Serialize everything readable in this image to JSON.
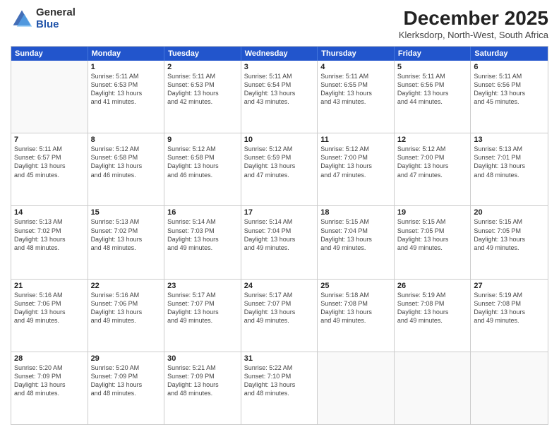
{
  "logo": {
    "general": "General",
    "blue": "Blue"
  },
  "title": "December 2025",
  "location": "Klerksdorp, North-West, South Africa",
  "header_days": [
    "Sunday",
    "Monday",
    "Tuesday",
    "Wednesday",
    "Thursday",
    "Friday",
    "Saturday"
  ],
  "weeks": [
    [
      {
        "day": "",
        "lines": []
      },
      {
        "day": "1",
        "lines": [
          "Sunrise: 5:11 AM",
          "Sunset: 6:53 PM",
          "Daylight: 13 hours",
          "and 41 minutes."
        ]
      },
      {
        "day": "2",
        "lines": [
          "Sunrise: 5:11 AM",
          "Sunset: 6:53 PM",
          "Daylight: 13 hours",
          "and 42 minutes."
        ]
      },
      {
        "day": "3",
        "lines": [
          "Sunrise: 5:11 AM",
          "Sunset: 6:54 PM",
          "Daylight: 13 hours",
          "and 43 minutes."
        ]
      },
      {
        "day": "4",
        "lines": [
          "Sunrise: 5:11 AM",
          "Sunset: 6:55 PM",
          "Daylight: 13 hours",
          "and 43 minutes."
        ]
      },
      {
        "day": "5",
        "lines": [
          "Sunrise: 5:11 AM",
          "Sunset: 6:56 PM",
          "Daylight: 13 hours",
          "and 44 minutes."
        ]
      },
      {
        "day": "6",
        "lines": [
          "Sunrise: 5:11 AM",
          "Sunset: 6:56 PM",
          "Daylight: 13 hours",
          "and 45 minutes."
        ]
      }
    ],
    [
      {
        "day": "7",
        "lines": [
          "Sunrise: 5:11 AM",
          "Sunset: 6:57 PM",
          "Daylight: 13 hours",
          "and 45 minutes."
        ]
      },
      {
        "day": "8",
        "lines": [
          "Sunrise: 5:12 AM",
          "Sunset: 6:58 PM",
          "Daylight: 13 hours",
          "and 46 minutes."
        ]
      },
      {
        "day": "9",
        "lines": [
          "Sunrise: 5:12 AM",
          "Sunset: 6:58 PM",
          "Daylight: 13 hours",
          "and 46 minutes."
        ]
      },
      {
        "day": "10",
        "lines": [
          "Sunrise: 5:12 AM",
          "Sunset: 6:59 PM",
          "Daylight: 13 hours",
          "and 47 minutes."
        ]
      },
      {
        "day": "11",
        "lines": [
          "Sunrise: 5:12 AM",
          "Sunset: 7:00 PM",
          "Daylight: 13 hours",
          "and 47 minutes."
        ]
      },
      {
        "day": "12",
        "lines": [
          "Sunrise: 5:12 AM",
          "Sunset: 7:00 PM",
          "Daylight: 13 hours",
          "and 47 minutes."
        ]
      },
      {
        "day": "13",
        "lines": [
          "Sunrise: 5:13 AM",
          "Sunset: 7:01 PM",
          "Daylight: 13 hours",
          "and 48 minutes."
        ]
      }
    ],
    [
      {
        "day": "14",
        "lines": [
          "Sunrise: 5:13 AM",
          "Sunset: 7:02 PM",
          "Daylight: 13 hours",
          "and 48 minutes."
        ]
      },
      {
        "day": "15",
        "lines": [
          "Sunrise: 5:13 AM",
          "Sunset: 7:02 PM",
          "Daylight: 13 hours",
          "and 48 minutes."
        ]
      },
      {
        "day": "16",
        "lines": [
          "Sunrise: 5:14 AM",
          "Sunset: 7:03 PM",
          "Daylight: 13 hours",
          "and 49 minutes."
        ]
      },
      {
        "day": "17",
        "lines": [
          "Sunrise: 5:14 AM",
          "Sunset: 7:04 PM",
          "Daylight: 13 hours",
          "and 49 minutes."
        ]
      },
      {
        "day": "18",
        "lines": [
          "Sunrise: 5:15 AM",
          "Sunset: 7:04 PM",
          "Daylight: 13 hours",
          "and 49 minutes."
        ]
      },
      {
        "day": "19",
        "lines": [
          "Sunrise: 5:15 AM",
          "Sunset: 7:05 PM",
          "Daylight: 13 hours",
          "and 49 minutes."
        ]
      },
      {
        "day": "20",
        "lines": [
          "Sunrise: 5:15 AM",
          "Sunset: 7:05 PM",
          "Daylight: 13 hours",
          "and 49 minutes."
        ]
      }
    ],
    [
      {
        "day": "21",
        "lines": [
          "Sunrise: 5:16 AM",
          "Sunset: 7:06 PM",
          "Daylight: 13 hours",
          "and 49 minutes."
        ]
      },
      {
        "day": "22",
        "lines": [
          "Sunrise: 5:16 AM",
          "Sunset: 7:06 PM",
          "Daylight: 13 hours",
          "and 49 minutes."
        ]
      },
      {
        "day": "23",
        "lines": [
          "Sunrise: 5:17 AM",
          "Sunset: 7:07 PM",
          "Daylight: 13 hours",
          "and 49 minutes."
        ]
      },
      {
        "day": "24",
        "lines": [
          "Sunrise: 5:17 AM",
          "Sunset: 7:07 PM",
          "Daylight: 13 hours",
          "and 49 minutes."
        ]
      },
      {
        "day": "25",
        "lines": [
          "Sunrise: 5:18 AM",
          "Sunset: 7:08 PM",
          "Daylight: 13 hours",
          "and 49 minutes."
        ]
      },
      {
        "day": "26",
        "lines": [
          "Sunrise: 5:19 AM",
          "Sunset: 7:08 PM",
          "Daylight: 13 hours",
          "and 49 minutes."
        ]
      },
      {
        "day": "27",
        "lines": [
          "Sunrise: 5:19 AM",
          "Sunset: 7:08 PM",
          "Daylight: 13 hours",
          "and 49 minutes."
        ]
      }
    ],
    [
      {
        "day": "28",
        "lines": [
          "Sunrise: 5:20 AM",
          "Sunset: 7:09 PM",
          "Daylight: 13 hours",
          "and 48 minutes."
        ]
      },
      {
        "day": "29",
        "lines": [
          "Sunrise: 5:20 AM",
          "Sunset: 7:09 PM",
          "Daylight: 13 hours",
          "and 48 minutes."
        ]
      },
      {
        "day": "30",
        "lines": [
          "Sunrise: 5:21 AM",
          "Sunset: 7:09 PM",
          "Daylight: 13 hours",
          "and 48 minutes."
        ]
      },
      {
        "day": "31",
        "lines": [
          "Sunrise: 5:22 AM",
          "Sunset: 7:10 PM",
          "Daylight: 13 hours",
          "and 48 minutes."
        ]
      },
      {
        "day": "",
        "lines": []
      },
      {
        "day": "",
        "lines": []
      },
      {
        "day": "",
        "lines": []
      }
    ]
  ]
}
